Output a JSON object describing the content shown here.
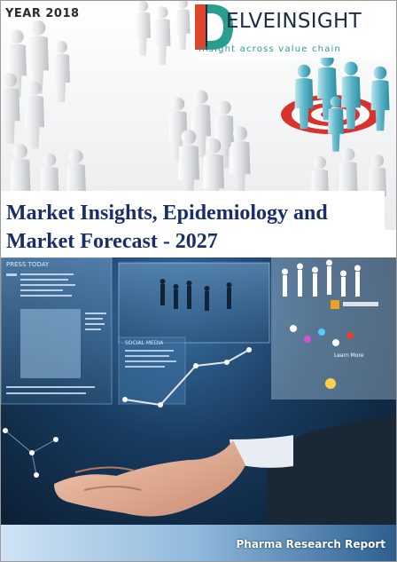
{
  "cover": {
    "year_label": "YEAR 2018",
    "title_line1": "Market Insights, Epidemiology and",
    "title_line2": "Market Forecast - 2027",
    "footer_label": "Pharma Research Report"
  },
  "brand": {
    "name": "ELVEINSIGHT",
    "tagline": "Insight across value chain",
    "logo": "delveinsight-logo",
    "colors": {
      "red": "#e0452c",
      "teal": "#2a9d8f",
      "navy": "#1e2b48"
    }
  },
  "images": {
    "top": "crowd-of-grey-figures-with-target",
    "bottom": "hand-holding-digital-interface"
  },
  "photo_text": {
    "board_heading": "PRESS TODAY",
    "panel_social": "SOCIAL MEDIA",
    "panel_button": "Learn More"
  },
  "colors": {
    "title": "#1a2d6b",
    "footer_dark": "#2d5e8e",
    "footer_light": "#cfe3f5"
  }
}
